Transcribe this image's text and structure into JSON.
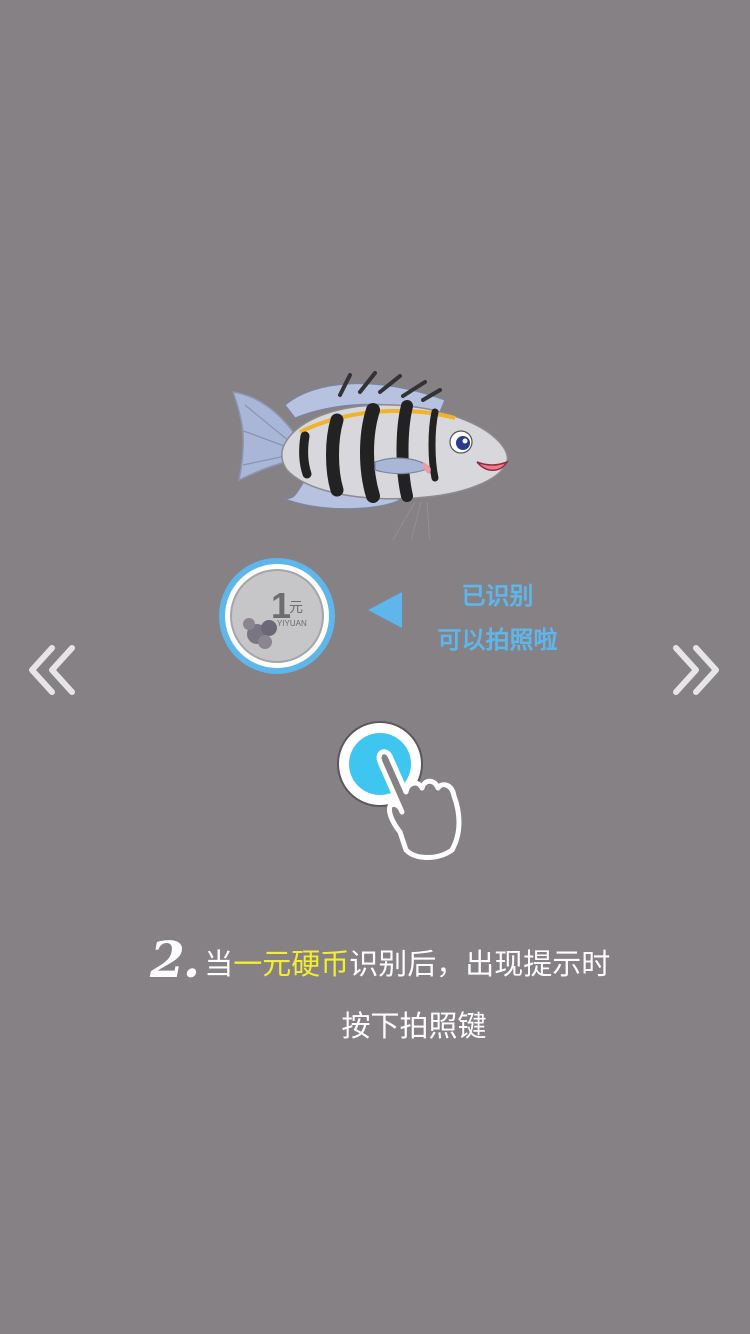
{
  "coin": {
    "number": "1",
    "unit": "元",
    "romanization": "YIYUAN"
  },
  "hint": {
    "line1": "已识别",
    "line2": "可以拍照啦"
  },
  "instruction": {
    "step_number": "2.",
    "line1_prefix": "当",
    "line1_highlight": "一元硬币",
    "line1_suffix": "识别后，出现提示时",
    "line2": "按下拍照键"
  },
  "colors": {
    "background": "#858185",
    "accent_blue": "#5fb6ea",
    "button_blue": "#3ec5f0",
    "highlight_yellow": "#f3ee2e"
  },
  "icons": {
    "prev": "double-chevron-left-icon",
    "next": "double-chevron-right-icon",
    "pointer": "triangle-left-icon",
    "hand": "hand-pointer-icon",
    "fish": "striped-fish-illustration"
  }
}
